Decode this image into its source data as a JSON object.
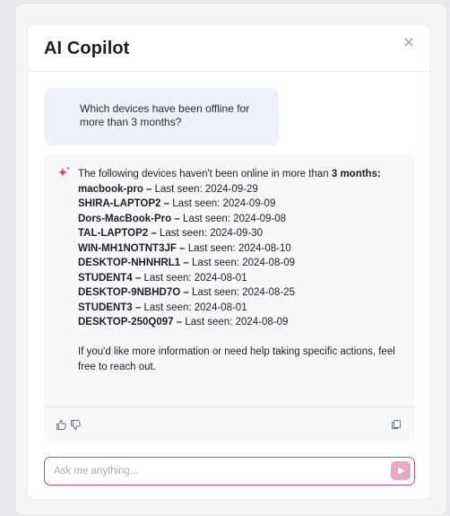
{
  "panel": {
    "title": "AI Copilot"
  },
  "user_message": {
    "text": "Which devices have been offline for more than 3 months?"
  },
  "ai_message": {
    "intro_prefix": "The following devices haven't been online in more than ",
    "intro_bold": "3 months:",
    "seen_prefix": "Last seen: ",
    "devices": [
      {
        "name": "macbook-pro",
        "last_seen": "2024-09-29"
      },
      {
        "name": "SHIRA-LAPTOP2",
        "last_seen": "2024-09-09"
      },
      {
        "name": "Dors-MacBook-Pro",
        "last_seen": "2024-09-08"
      },
      {
        "name": "TAL-LAPTOP2",
        "last_seen": "2024-09-30"
      },
      {
        "name": "WIN-MH1NOTNT3JF",
        "last_seen": "2024-08-10"
      },
      {
        "name": "DESKTOP-NHNHRL1",
        "last_seen": "2024-08-09"
      },
      {
        "name": "STUDENT4",
        "last_seen": "2024-08-01"
      },
      {
        "name": "DESKTOP-9NBHD7O",
        "last_seen": "2024-08-25"
      },
      {
        "name": "STUDENT3",
        "last_seen": "2024-08-01"
      },
      {
        "name": "DESKTOP-250Q097",
        "last_seen": "2024-08-09"
      }
    ],
    "closing": "If you'd like more information or need help taking specific actions, feel free to reach out."
  },
  "footer_icons": {
    "like": "thumbs-up-icon",
    "dislike": "thumbs-down-icon",
    "copy": "copy-icon"
  },
  "composer": {
    "placeholder": "Ask me anything...",
    "value": ""
  },
  "colors": {
    "accent": "#c9477d",
    "send_button": "#e7a9c4",
    "user_bubble": "#eef1f7"
  }
}
